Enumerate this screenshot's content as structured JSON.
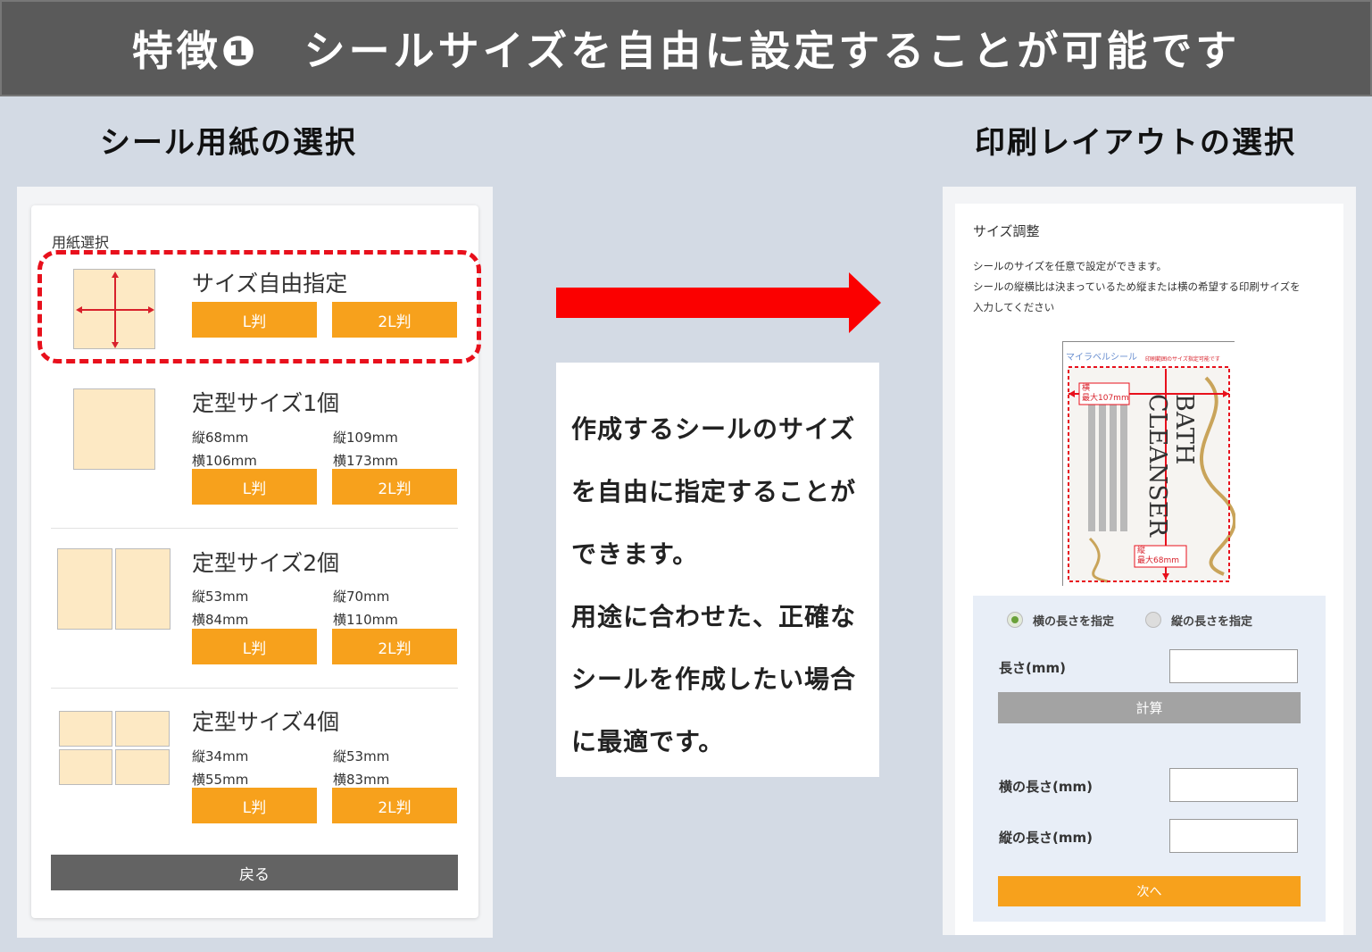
{
  "banner": {
    "title": "特徴❶　シールサイズを自由に設定することが可能です"
  },
  "left_heading": "シール用紙の選択",
  "right_heading": "印刷レイアウトの選択",
  "paper_select": {
    "label": "用紙選択",
    "options": [
      {
        "title": "サイズ自由指定",
        "l_button": "L判",
        "l2_button": "2L判"
      },
      {
        "title": "定型サイズ1個",
        "l_h": "縦68mm",
        "l_w": "横106mm",
        "l2_h": "縦109mm",
        "l2_w": "横173mm",
        "l_button": "L判",
        "l2_button": "2L判"
      },
      {
        "title": "定型サイズ2個",
        "l_h": "縦53mm",
        "l_w": "横84mm",
        "l2_h": "縦70mm",
        "l2_w": "横110mm",
        "l_button": "L判",
        "l2_button": "2L判"
      },
      {
        "title": "定型サイズ4個",
        "l_h": "縦34mm",
        "l_w": "横55mm",
        "l2_h": "縦53mm",
        "l2_w": "横83mm",
        "l_button": "L判",
        "l2_button": "2L判"
      }
    ],
    "back_button": "戻る"
  },
  "description": {
    "lines": [
      "作成するシールのサイズ",
      "を自由に指定することが",
      "できます。",
      "用途に合わせた、正確な",
      "シールを作成したい場合",
      "に最適です。"
    ]
  },
  "size_adjust": {
    "title": "サイズ調整",
    "instructions": [
      "シールのサイズを任意で設定ができます。",
      "シールの縦横比は決まっているため縦または横の希望する印刷サイズを",
      "入力してください"
    ],
    "preview": {
      "brand": "マイラベルシール",
      "header_note": "印刷範囲のサイズ指定可能です",
      "width_label": "横",
      "width_max": "最大107mm",
      "height_label": "縦",
      "height_max": "最大68mm",
      "product_line1": "BATH",
      "product_line2": "CLEANSER"
    },
    "radio_width": "横の長さを指定",
    "radio_height": "縦の長さを指定",
    "length_label": "長さ(mm)",
    "calc_button": "計算",
    "width_length_label": "横の長さ(mm)",
    "height_length_label": "縦の長さ(mm)",
    "next_button": "次へ"
  },
  "colors": {
    "accent_orange": "#f7a11c",
    "arrow_red": "#fb0000",
    "banner_gray": "#5a5a5a",
    "highlight_red": "#e8101c"
  }
}
